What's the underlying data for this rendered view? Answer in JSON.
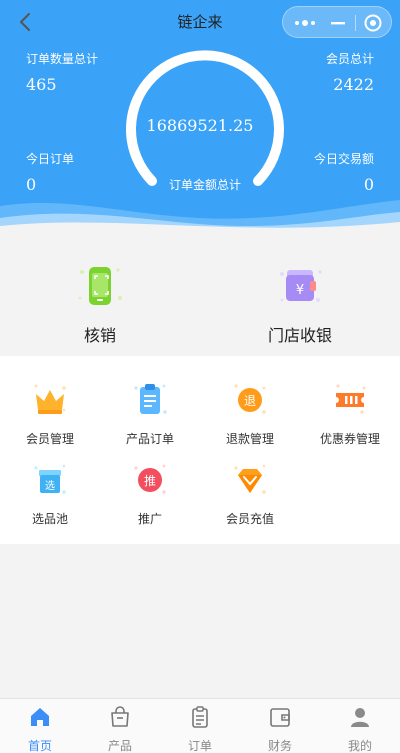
{
  "nav": {
    "title": "链企来"
  },
  "stats": {
    "order_count_label": "订单数量总计",
    "order_count": "465",
    "member_total_label": "会员总计",
    "member_total": "2422",
    "today_orders_label": "今日订单",
    "today_orders": "0",
    "today_amount_label": "今日交易额",
    "today_amount": "0",
    "order_amount_total": "16869521.25",
    "order_amount_total_label": "订单金额总计"
  },
  "quick": [
    {
      "label": "核销",
      "icon": "verify-phone-icon"
    },
    {
      "label": "门店收银",
      "icon": "cashier-wallet-icon"
    }
  ],
  "grid": [
    {
      "label": "会员管理",
      "icon": "crown-icon"
    },
    {
      "label": "产品订单",
      "icon": "order-clipboard-icon"
    },
    {
      "label": "退款管理",
      "icon": "refund-icon",
      "glyph": "退"
    },
    {
      "label": "优惠券管理",
      "icon": "coupon-icon"
    },
    {
      "label": "选品池",
      "icon": "selection-box-icon",
      "glyph": "选"
    },
    {
      "label": "推广",
      "icon": "promote-icon",
      "glyph": "推"
    },
    {
      "label": "会员充值",
      "icon": "diamond-icon"
    }
  ],
  "tabs": [
    {
      "label": "首页",
      "icon": "home-icon",
      "active": true
    },
    {
      "label": "产品",
      "icon": "product-bag-icon",
      "active": false
    },
    {
      "label": "订单",
      "icon": "order-clipboard-icon",
      "active": false
    },
    {
      "label": "财务",
      "icon": "wallet-icon",
      "active": false
    },
    {
      "label": "我的",
      "icon": "user-icon",
      "active": false
    }
  ],
  "colors": {
    "primary": "#3aa2f7",
    "tab_active": "#3a8ef5"
  }
}
